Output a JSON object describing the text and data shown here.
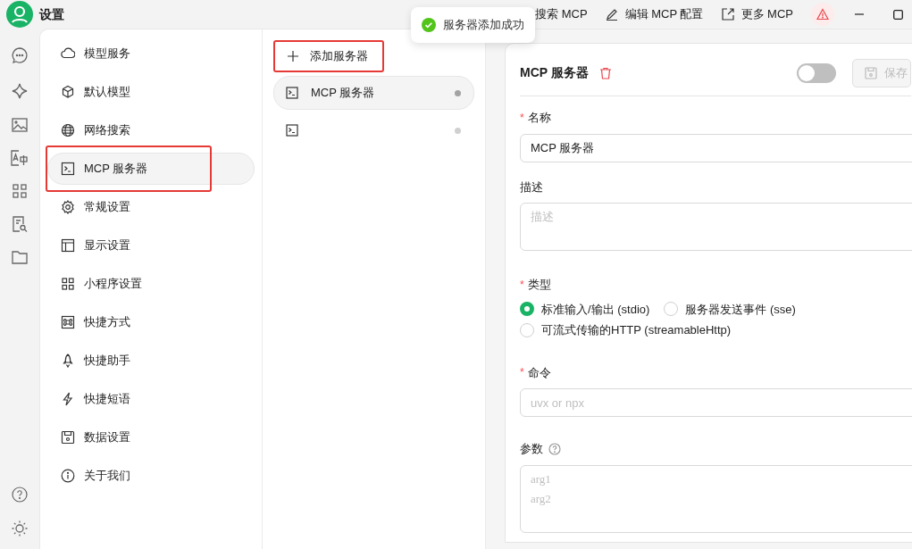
{
  "window": {
    "title": "设置"
  },
  "toolbar": [
    {
      "kind": "search",
      "label": "搜索 MCP"
    },
    {
      "kind": "edit",
      "label": "编辑 MCP 配置"
    },
    {
      "kind": "external",
      "label": "更多 MCP"
    },
    {
      "kind": "warning"
    }
  ],
  "toast": {
    "text": "服务器添加成功"
  },
  "menu": [
    {
      "label": "模型服务",
      "selected": false,
      "highlighted": false
    },
    {
      "label": "默认模型",
      "selected": false,
      "highlighted": false
    },
    {
      "label": "网络搜索",
      "selected": false,
      "highlighted": false
    },
    {
      "label": "MCP 服务器",
      "selected": true,
      "highlighted": true
    },
    {
      "label": "常规设置",
      "selected": false,
      "highlighted": false
    },
    {
      "label": "显示设置",
      "selected": false,
      "highlighted": false
    },
    {
      "label": "小程序设置",
      "selected": false,
      "highlighted": false
    },
    {
      "label": "快捷方式",
      "selected": false,
      "highlighted": false
    },
    {
      "label": "快捷助手",
      "selected": false,
      "highlighted": false
    },
    {
      "label": "快捷短语",
      "selected": false,
      "highlighted": false
    },
    {
      "label": "数据设置",
      "selected": false,
      "highlighted": false
    },
    {
      "label": "关于我们",
      "selected": false,
      "highlighted": false
    }
  ],
  "add_button": {
    "label": "添加服务器",
    "highlighted": true
  },
  "servers": [
    {
      "name": "MCP 服务器",
      "selected": true,
      "color": "#a3a3a3"
    },
    {
      "selected": false,
      "color": "#d0d0d0"
    }
  ],
  "detail": {
    "title": "MCP 服务器",
    "enabled": false,
    "save": {
      "label": "保存",
      "disabled": true
    },
    "name": {
      "label": "名称",
      "mark": "*",
      "value": "MCP 服务器"
    },
    "description": {
      "label": "描述",
      "placeholder": "描述"
    },
    "type": {
      "label": "类型",
      "mark": "*",
      "options": [
        {
          "label": "标准输入/输出 (stdio)",
          "selected": true
        },
        {
          "label": "服务器发送事件 (sse)",
          "selected": false
        },
        {
          "label": "可流式传输的HTTP (streamableHttp)",
          "selected": false
        }
      ]
    },
    "command": {
      "label": "命令",
      "mark": "*",
      "placeholder": "uvx or npx"
    },
    "args": {
      "label": "参数",
      "placeholder": "arg1\narg2"
    }
  }
}
